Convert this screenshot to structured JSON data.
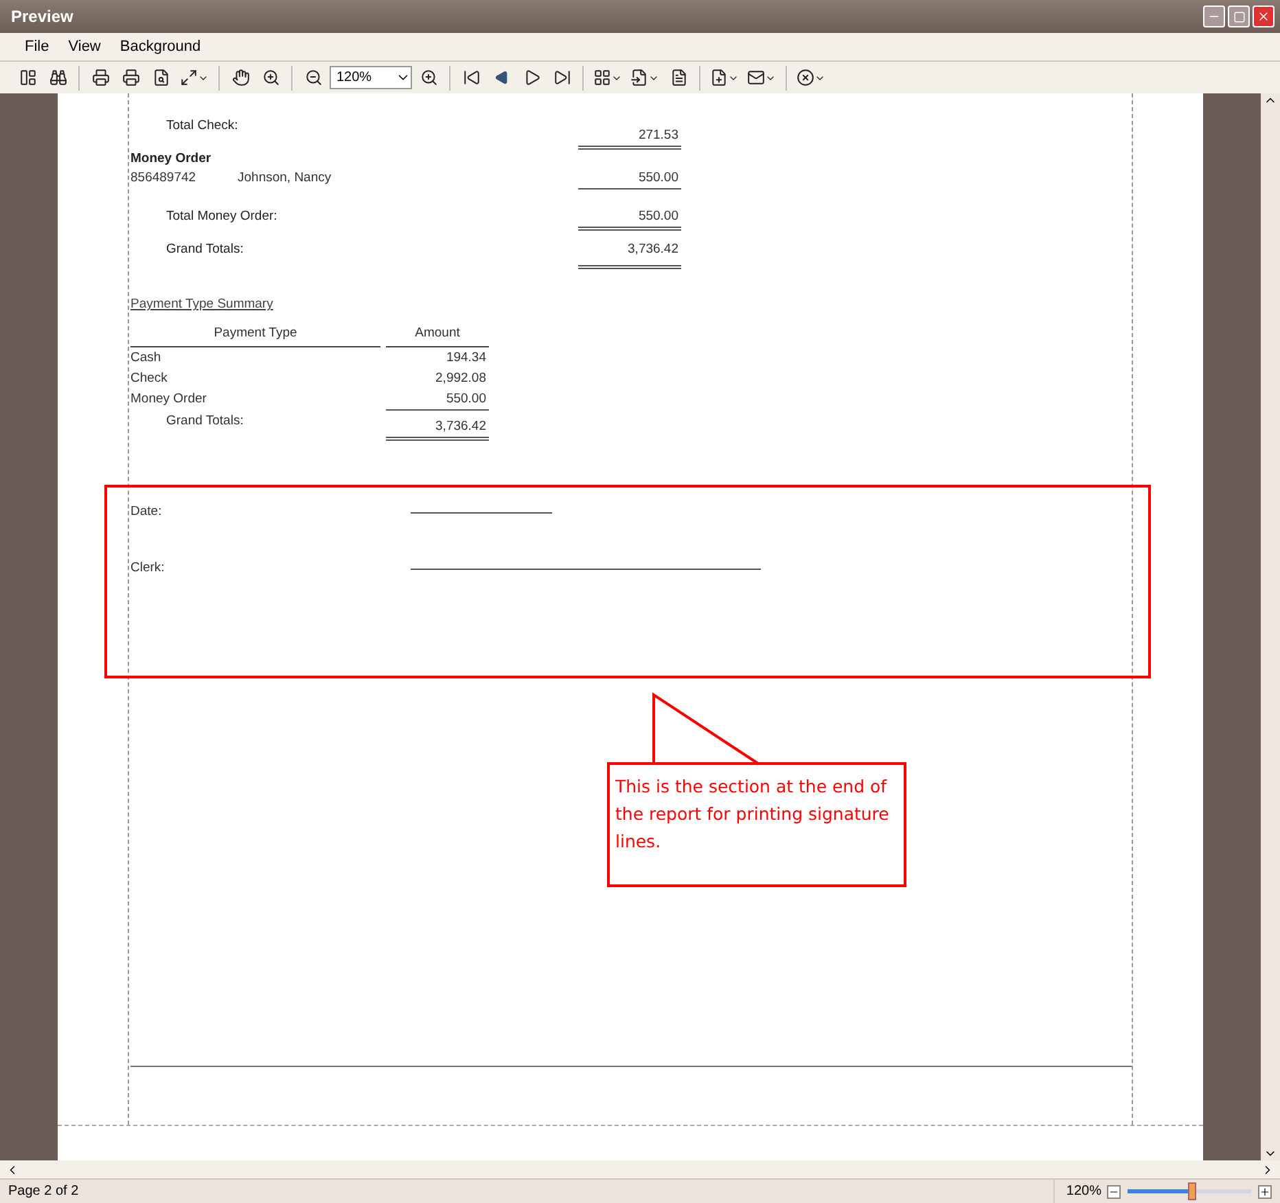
{
  "window": {
    "title": "Preview"
  },
  "menu": [
    "File",
    "View",
    "Background"
  ],
  "toolbar": {
    "zoom_value": "120%"
  },
  "report": {
    "total_check": {
      "label": "Total Check:",
      "amount": "271.53"
    },
    "group": {
      "title": "Money Order",
      "rows": [
        {
          "number": "856489742",
          "name": "Johnson, Nancy",
          "amount": "550.00"
        }
      ]
    },
    "total_group": {
      "label": "Total Money Order:",
      "amount": "550.00"
    },
    "grand_total": {
      "label": "Grand Totals:",
      "amount": "3,736.42"
    },
    "summary": {
      "title": "Payment Type Summary",
      "columns": [
        "Payment Type",
        "Amount"
      ],
      "rows": [
        {
          "type": "Cash",
          "amount": "194.34"
        },
        {
          "type": "Check",
          "amount": "2,992.08"
        },
        {
          "type": "Money Order",
          "amount": "550.00"
        }
      ],
      "total": {
        "label": "Grand Totals:",
        "amount": "3,736.42"
      }
    },
    "signature_lines": [
      {
        "label": "Date:",
        "kind": "short"
      },
      {
        "label": "Clerk:",
        "kind": "long"
      }
    ]
  },
  "callout": {
    "text": "This is the section at the end of the report for printing signature lines."
  },
  "status_bar": {
    "page": "Page 2 of 2",
    "zoom": "120%",
    "level": 0.52
  }
}
